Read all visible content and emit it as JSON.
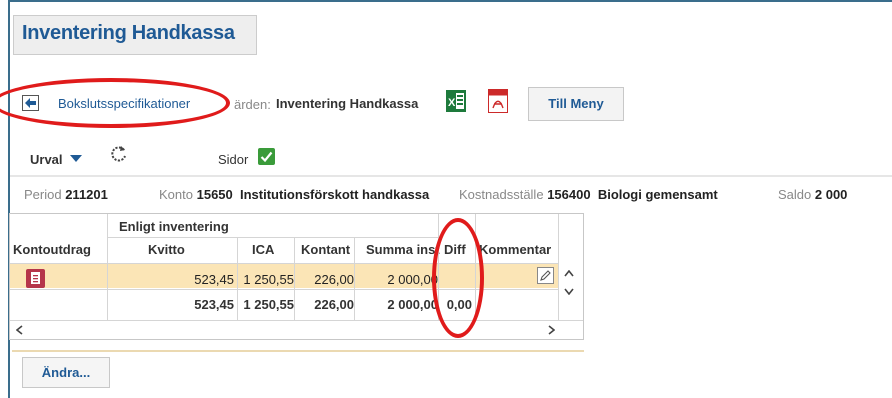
{
  "page": {
    "title": "Inventering Handkassa"
  },
  "breadcrumb": {
    "link_label": "Bokslutsspecifikationer",
    "label": "ärden:",
    "value": "Inventering Handkassa"
  },
  "toolbar": {
    "excel_icon": "excel-icon",
    "pdf_icon": "pdf-icon",
    "menu_button": "Till Meny"
  },
  "filters": {
    "urval_label": "Urval",
    "sidor_label": "Sidor",
    "sidor_checked": true
  },
  "info": {
    "period_label": "Period",
    "period_value": "211201",
    "konto_label": "Konto",
    "konto_value": "15650",
    "konto_name": "Institutionsförskott handkassa",
    "kostnadsstalle_label": "Kostnadsställe",
    "kostnadsstalle_value": "156400",
    "kostnadsstalle_name": "Biologi gemensamt",
    "saldo_label": "Saldo",
    "saldo_value": "2 000"
  },
  "table": {
    "group_header": "Enligt inventering",
    "columns": [
      "Kontoutdrag",
      "Kvitto",
      "ICA",
      "Kontant",
      "Summa inst",
      "Diff",
      "Kommentar"
    ],
    "rows": [
      {
        "kvitto": "523,45",
        "ica": "1 250,55",
        "kontant": "226,00",
        "summa": "2 000,00",
        "diff": ""
      }
    ],
    "totals": {
      "kvitto": "523,45",
      "ica": "1 250,55",
      "kontant": "226,00",
      "summa": "2 000,00",
      "diff": "0,00"
    }
  },
  "actions": {
    "andra_button": "Ändra..."
  },
  "colors": {
    "accent": "#1f5a95",
    "row_highlight": "#fbe5b6",
    "annotation": "#e01b1b",
    "check": "#3a9b3a"
  }
}
